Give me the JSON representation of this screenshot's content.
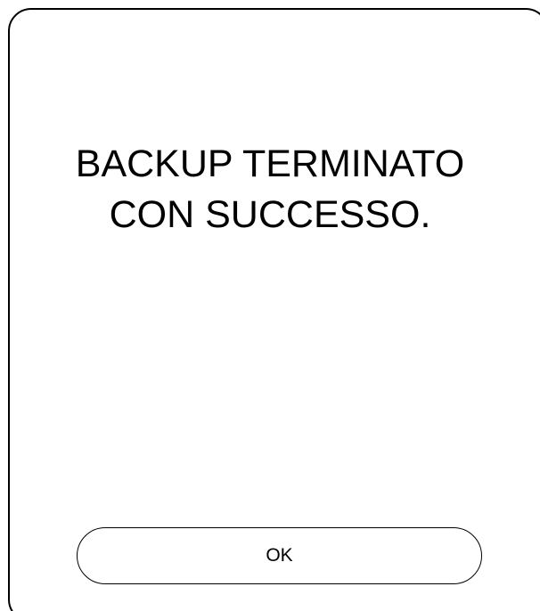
{
  "dialog": {
    "message_line1": "BACKUP TERMINATO",
    "message_line2": "CON SUCCESSO.",
    "ok_label": "OK"
  }
}
